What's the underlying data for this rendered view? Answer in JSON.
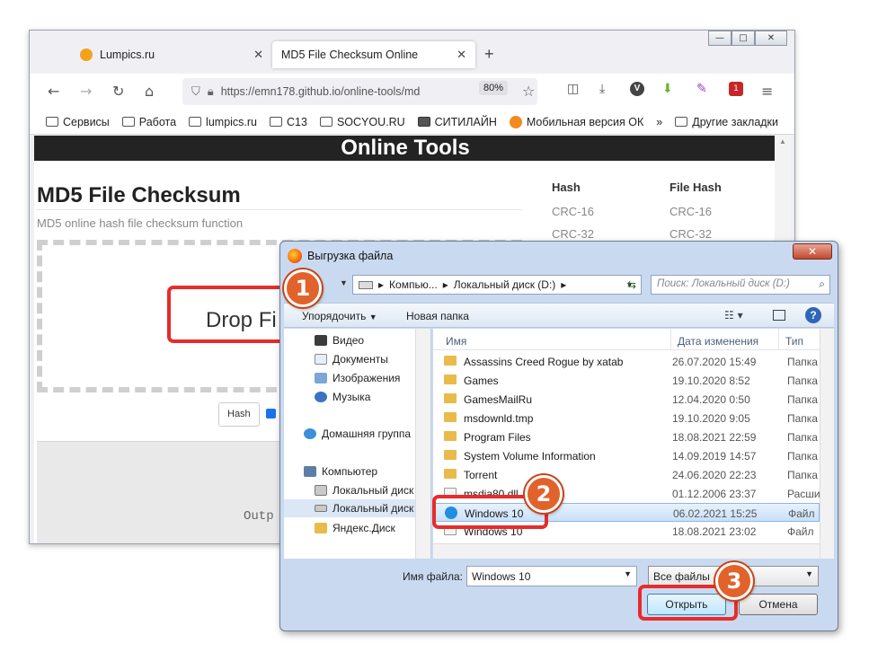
{
  "browser": {
    "tabs": [
      {
        "label": "Lumpics.ru",
        "close": "✕"
      },
      {
        "label": "MD5 File Checksum Online",
        "close": "✕"
      }
    ],
    "new_tab": "+",
    "url": "https://emn178.github.io/online-tools/md",
    "zoom": "80%",
    "ext_badge": "1",
    "bookmarks": [
      "Сервисы",
      "Работа",
      "lumpics.ru",
      "C13",
      "SOCYOU.RU",
      "СИТИЛАЙН",
      "Мобильная версия ОК"
    ],
    "more": "»",
    "other_bookmarks": "Другие закладки"
  },
  "page": {
    "banner": "Online Tools",
    "title": "MD5 File Checksum",
    "subtitle": "MD5 online hash file checksum function",
    "drop_text": "Drop Fi",
    "hash_button": "Hash",
    "output_text": "Outp",
    "hash_list": {
      "col1_header": "Hash",
      "col1": [
        "CRC-16",
        "CRC-32"
      ],
      "col2_header": "File Hash",
      "col2": [
        "CRC-16",
        "CRC-32"
      ]
    }
  },
  "dialog": {
    "title": "Выгрузка файла",
    "close": "✕",
    "breadcrumb": [
      "Компью...",
      "Локальный диск (D:)"
    ],
    "search_placeholder": "Поиск: Локальный диск (D:)",
    "commands": {
      "organize": "Упорядочить",
      "new_folder": "Новая папка"
    },
    "nav_items": [
      "Видео",
      "Документы",
      "Изображения",
      "Музыка",
      "Домашняя группа",
      "Компьютер",
      "Локальный диск",
      "Локальный диск",
      "Яндекс.Диск"
    ],
    "columns": {
      "name": "Имя",
      "date": "Дата изменения",
      "type": "Тип"
    },
    "files": [
      {
        "name": "Assassins Creed Rogue by xatab",
        "date": "26.07.2020 15:49",
        "type": "Папка",
        "kind": "folder"
      },
      {
        "name": "Games",
        "date": "19.10.2020 8:52",
        "type": "Папка",
        "kind": "folder"
      },
      {
        "name": "GamesMailRu",
        "date": "12.04.2020 0:50",
        "type": "Папка",
        "kind": "folder"
      },
      {
        "name": "msdownld.tmp",
        "date": "19.10.2020 9:05",
        "type": "Папка",
        "kind": "folder"
      },
      {
        "name": "Program Files",
        "date": "18.08.2021 22:59",
        "type": "Папка",
        "kind": "folder"
      },
      {
        "name": "System Volume Information",
        "date": "14.09.2019 14:57",
        "type": "Папка",
        "kind": "folder"
      },
      {
        "name": "Torrent",
        "date": "24.06.2020 22:23",
        "type": "Папка",
        "kind": "folder"
      },
      {
        "name": "msdia80.dll",
        "date": "01.12.2006 23:37",
        "type": "Расши",
        "kind": "file"
      },
      {
        "name": "Windows 10",
        "date": "06.02.2021 15:25",
        "type": "Файл",
        "kind": "iso",
        "selected": true
      },
      {
        "name": "Windows 10",
        "date": "18.08.2021 23:02",
        "type": "Файл",
        "kind": "file"
      }
    ],
    "filename_label": "Имя файла:",
    "filename_value": "Windows 10",
    "filetype_value": "Все файлы",
    "open_button": "Открыть",
    "cancel_button": "Отмена"
  },
  "callouts": [
    "1",
    "2",
    "3"
  ],
  "colors": {
    "callout_border": "#e82b2b",
    "callout_badge": "#e2622b",
    "banner_bg": "#232323",
    "folder": "#e8bb4a"
  }
}
